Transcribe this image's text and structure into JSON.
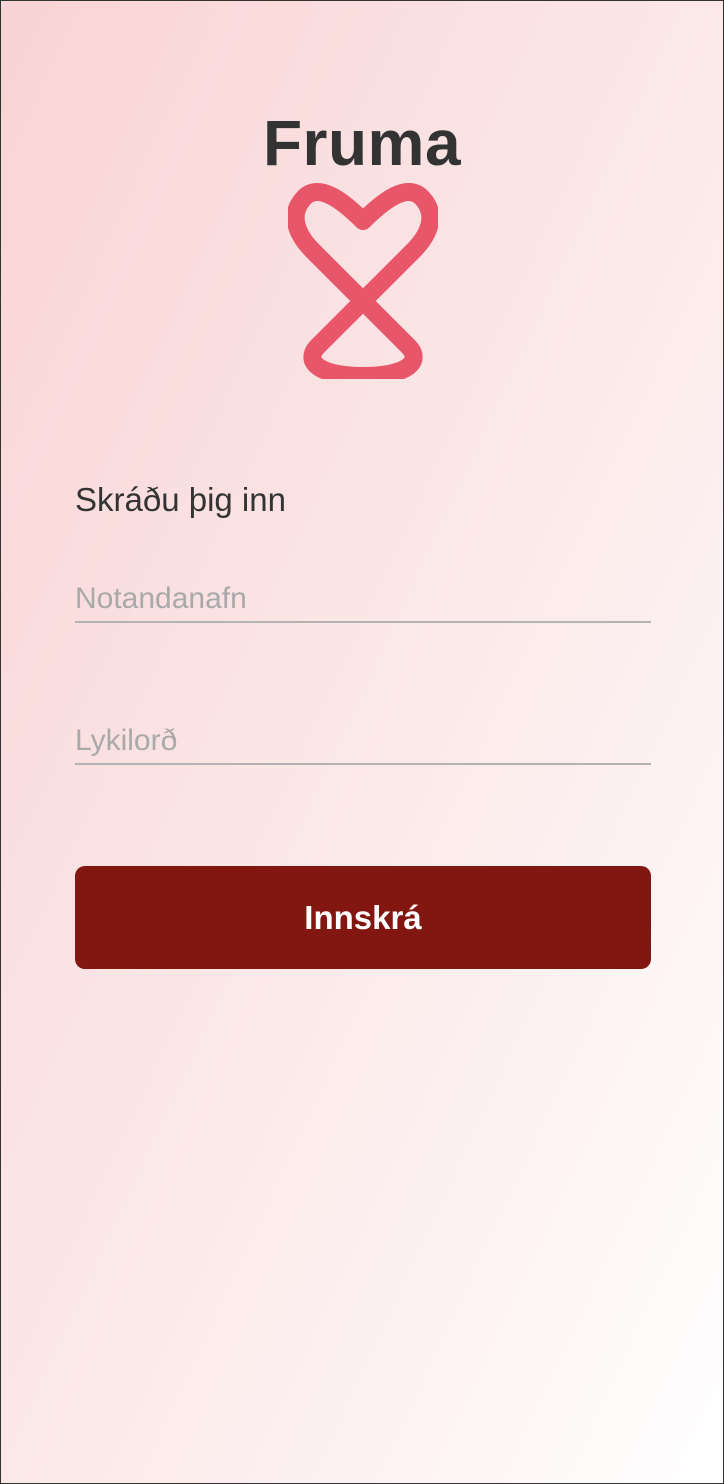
{
  "app": {
    "title": "Fruma",
    "logo_icon": "heart-loop-ribbon-icon",
    "logo_color": "#e8566a"
  },
  "login": {
    "heading": "Skráðu þig inn",
    "username_placeholder": "Notandanafn",
    "username_value": "",
    "password_placeholder": "Lykilorð",
    "password_value": "",
    "submit_label": "Innskrá",
    "submit_color": "#821610"
  }
}
